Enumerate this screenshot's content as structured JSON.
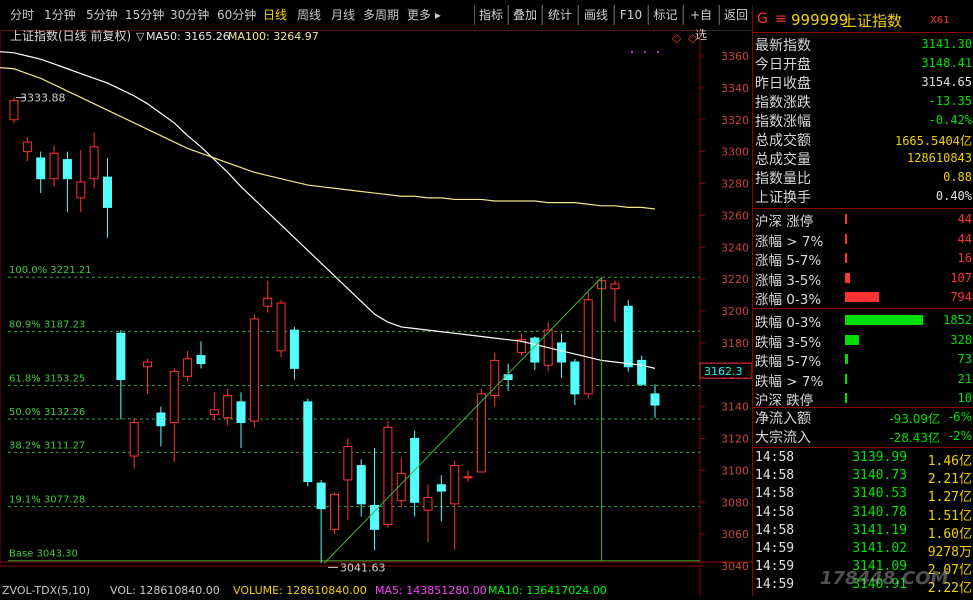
{
  "toolbar": {
    "periods": [
      "分时",
      "1分钟",
      "5分钟",
      "15分钟",
      "30分钟",
      "60分钟",
      "日线",
      "周线",
      "月线",
      "多周期",
      "更多 ▸"
    ],
    "active_period": "日线",
    "buttons": [
      "指标",
      "叠加",
      "统计",
      "画线",
      "F10",
      "标记",
      "+自选",
      "返回"
    ]
  },
  "chart": {
    "header_name": "上证指数(日线 前复权)",
    "header_marker": "▽",
    "ma50_label": "MA50: 3165.26",
    "ma100_label": "MA100: 3264.97",
    "high_label": "3333.88",
    "low_label": "3041.63",
    "current_price_tag": "3162.3",
    "fib_levels": [
      {
        "label": "100.0% 3221.21",
        "value": 3221.21
      },
      {
        "label": "80.9% 3187.23",
        "value": 3187.23
      },
      {
        "label": "61.8% 3153.25",
        "value": 3153.25
      },
      {
        "label": "50.0% 3132.26",
        "value": 3132.26
      },
      {
        "label": "38.2% 3111.27",
        "value": 3111.27
      },
      {
        "label": "19.1% 3077.28",
        "value": 3077.28
      },
      {
        "label": "Base 3043.30",
        "value": 3043.3
      }
    ],
    "y_axis_ticks": [
      3360,
      3340,
      3320,
      3300,
      3280,
      3260,
      3240,
      3220,
      3200,
      3180,
      3160,
      3140,
      3120,
      3100,
      3080,
      3060,
      3040
    ],
    "volume_header": {
      "name": "ZVOL-TDX(5,10)",
      "vol": "VOL: 128610840.00",
      "volume": "VOLUME: 128610840.00",
      "ma5": "MA5: 143851280.00",
      "ma10": "MA10: 136417024.00"
    },
    "colors": {
      "up": "#ff3232",
      "down": "#54ffff",
      "ma50": "#ffffff",
      "ma100": "#f0e68c",
      "fib": "#3c9a3c",
      "trend": "#3cb83c"
    }
  },
  "chart_data": {
    "type": "candlestick",
    "title": "上证指数(日线 前复权)",
    "ylim": [
      3035,
      3368
    ],
    "candles": [
      {
        "o": 3320,
        "c": 3332,
        "h": 3334,
        "l": 3318
      },
      {
        "o": 3300,
        "c": 3306,
        "h": 3309,
        "l": 3294
      },
      {
        "o": 3296,
        "c": 3283,
        "h": 3300,
        "l": 3274
      },
      {
        "o": 3283,
        "c": 3299,
        "h": 3304,
        "l": 3278
      },
      {
        "o": 3295,
        "c": 3283,
        "h": 3300,
        "l": 3262
      },
      {
        "o": 3271,
        "c": 3281,
        "h": 3301,
        "l": 3262
      },
      {
        "o": 3283,
        "c": 3303,
        "h": 3312,
        "l": 3277
      },
      {
        "o": 3284,
        "c": 3265,
        "h": 3296,
        "l": 3246
      },
      {
        "o": 3186,
        "c": 3157,
        "h": 3188,
        "l": 3132
      },
      {
        "o": 3109,
        "c": 3130,
        "h": 3133,
        "l": 3101
      },
      {
        "o": 3165,
        "c": 3168,
        "h": 3170,
        "l": 3148
      },
      {
        "o": 3136,
        "c": 3128,
        "h": 3140,
        "l": 3115
      },
      {
        "o": 3130,
        "c": 3162,
        "h": 3164,
        "l": 3105
      },
      {
        "o": 3159,
        "c": 3170,
        "h": 3175,
        "l": 3156
      },
      {
        "o": 3172,
        "c": 3167,
        "h": 3181,
        "l": 3164
      },
      {
        "o": 3135,
        "c": 3138,
        "h": 3149,
        "l": 3131
      },
      {
        "o": 3133,
        "c": 3147,
        "h": 3151,
        "l": 3128
      },
      {
        "o": 3143,
        "c": 3130,
        "h": 3149,
        "l": 3114
      },
      {
        "o": 3131,
        "c": 3195,
        "h": 3198,
        "l": 3127
      },
      {
        "o": 3203,
        "c": 3208,
        "h": 3219,
        "l": 3199
      },
      {
        "o": 3175,
        "c": 3205,
        "h": 3207,
        "l": 3171
      },
      {
        "o": 3188,
        "c": 3164,
        "h": 3190,
        "l": 3157
      },
      {
        "o": 3143,
        "c": 3093,
        "h": 3145,
        "l": 3090
      },
      {
        "o": 3092,
        "c": 3076,
        "h": 3094,
        "l": 3042
      },
      {
        "o": 3063,
        "c": 3085,
        "h": 3086,
        "l": 3060
      },
      {
        "o": 3094,
        "c": 3115,
        "h": 3120,
        "l": 3069
      },
      {
        "o": 3103,
        "c": 3079,
        "h": 3107,
        "l": 3071
      },
      {
        "o": 3078,
        "c": 3063,
        "h": 3114,
        "l": 3050
      },
      {
        "o": 3066,
        "c": 3127,
        "h": 3131,
        "l": 3064
      },
      {
        "o": 3081,
        "c": 3098,
        "h": 3108,
        "l": 3077
      },
      {
        "o": 3120,
        "c": 3080,
        "h": 3125,
        "l": 3071
      },
      {
        "o": 3075,
        "c": 3083,
        "h": 3091,
        "l": 3055
      },
      {
        "o": 3091,
        "c": 3087,
        "h": 3097,
        "l": 3068
      },
      {
        "o": 3079,
        "c": 3103,
        "h": 3106,
        "l": 3050
      },
      {
        "o": 3096,
        "c": 3096,
        "h": 3100,
        "l": 3093
      },
      {
        "o": 3099,
        "c": 3148,
        "h": 3151,
        "l": 3099
      },
      {
        "o": 3147,
        "c": 3169,
        "h": 3174,
        "l": 3140
      },
      {
        "o": 3160,
        "c": 3157,
        "h": 3167,
        "l": 3150
      },
      {
        "o": 3174,
        "c": 3182,
        "h": 3186,
        "l": 3172
      },
      {
        "o": 3183,
        "c": 3168,
        "h": 3184,
        "l": 3163
      },
      {
        "o": 3166,
        "c": 3188,
        "h": 3193,
        "l": 3162
      },
      {
        "o": 3180,
        "c": 3168,
        "h": 3186,
        "l": 3158
      },
      {
        "o": 3168,
        "c": 3148,
        "h": 3170,
        "l": 3141
      },
      {
        "o": 3148,
        "c": 3207,
        "h": 3212,
        "l": 3145
      },
      {
        "o": 3214,
        "c": 3219,
        "h": 3221,
        "l": 3201
      },
      {
        "o": 3214,
        "c": 3217,
        "h": 3219,
        "l": 3193
      },
      {
        "o": 3203,
        "c": 3165,
        "h": 3207,
        "l": 3162
      },
      {
        "o": 3169,
        "c": 3154,
        "h": 3172,
        "l": 3153
      },
      {
        "o": 3148,
        "c": 3141,
        "h": 3154,
        "l": 3133
      }
    ],
    "ma50": [
      3362,
      3360,
      3358,
      3355,
      3352,
      3349,
      3346,
      3343,
      3339,
      3335,
      3330,
      3324,
      3318,
      3310,
      3303,
      3295,
      3287,
      3278,
      3270,
      3262,
      3254,
      3246,
      3238,
      3230,
      3222,
      3214,
      3206,
      3198,
      3193,
      3190,
      3189,
      3188,
      3187,
      3186,
      3185,
      3184,
      3183,
      3182,
      3181,
      3179,
      3177,
      3175,
      3173,
      3171,
      3169,
      3168,
      3167,
      3166,
      3164
    ],
    "ma100": [
      3352,
      3349,
      3346,
      3342,
      3338,
      3334,
      3330,
      3326,
      3322,
      3318,
      3314,
      3310,
      3306,
      3302,
      3299,
      3296,
      3293,
      3290,
      3287,
      3285,
      3283,
      3281,
      3279,
      3278,
      3277,
      3276,
      3275,
      3274,
      3273,
      3272,
      3272,
      3271,
      3271,
      3270,
      3270,
      3270,
      3269,
      3269,
      3269,
      3269,
      3268,
      3268,
      3268,
      3267,
      3266,
      3266,
      3265,
      3265,
      3264
    ]
  },
  "panel": {
    "header": {
      "flag": "G",
      "menu": "≡",
      "code": "999999",
      "name": "上证指数",
      "tag": "X61"
    },
    "stats": [
      {
        "label": "最新指数",
        "value": "3141.30",
        "color": "#00e000"
      },
      {
        "label": "今日开盘",
        "value": "3148.41",
        "color": "#00e000"
      },
      {
        "label": "昨日收盘",
        "value": "3154.65",
        "color": "#e0e0e0"
      },
      {
        "label": "指数涨跌",
        "value": "-13.35",
        "color": "#00e000"
      },
      {
        "label": "指数涨幅",
        "value": "-0.42%",
        "color": "#00e000"
      },
      {
        "label": "总成交额",
        "value": "1665.5404亿",
        "color": "#f0d000"
      },
      {
        "label": "总成交量",
        "value": "128610843",
        "color": "#f0d000"
      },
      {
        "label": "指数量比",
        "value": "0.88",
        "color": "#f0d000"
      },
      {
        "label": "上证换手",
        "value": "0.40%",
        "color": "#e0e0e0"
      }
    ],
    "breadth": [
      {
        "label": "沪深 涨停",
        "value": "44",
        "color": "#ff3232",
        "bar": 0.005
      },
      {
        "label": "涨幅 > 7%",
        "value": "44",
        "color": "#ff3232",
        "bar": 0.005
      },
      {
        "label": "涨幅 5-7%",
        "value": "16",
        "color": "#ff3232",
        "bar": 0.005
      },
      {
        "label": "涨幅 3-5%",
        "value": "107",
        "color": "#ff3232",
        "bar": 0.07
      },
      {
        "label": "涨幅 0-3%",
        "value": "794",
        "color": "#ff3232",
        "bar": 0.43
      },
      {
        "label": "跌幅 0-3%",
        "value": "1852",
        "color": "#00e000",
        "bar": 1.0
      },
      {
        "label": "跌幅 3-5%",
        "value": "328",
        "color": "#00e000",
        "bar": 0.18
      },
      {
        "label": "跌幅 5-7%",
        "value": "73",
        "color": "#00e000",
        "bar": 0.04
      },
      {
        "label": "跌幅 > 7%",
        "value": "21",
        "color": "#00e000",
        "bar": 0.01
      },
      {
        "label": "沪深 跌停",
        "value": "10",
        "color": "#00e000",
        "bar": 0.005
      }
    ],
    "flows": [
      {
        "label": "净流入额",
        "value": "-93.09亿",
        "pct": "-6%"
      },
      {
        "label": "大宗流入",
        "value": "-28.43亿",
        "pct": "-2%"
      }
    ],
    "ticks": [
      {
        "time": "14:58",
        "price": "3139.99",
        "vol": "1.46亿"
      },
      {
        "time": "14:58",
        "price": "3140.73",
        "vol": "2.21亿"
      },
      {
        "time": "14:58",
        "price": "3140.53",
        "vol": "1.27亿"
      },
      {
        "time": "14:58",
        "price": "3140.78",
        "vol": "1.51亿"
      },
      {
        "time": "14:58",
        "price": "3141.19",
        "vol": "1.60亿"
      },
      {
        "time": "14:59",
        "price": "3141.02",
        "vol": "9278万"
      },
      {
        "time": "14:59",
        "price": "3141.09",
        "vol": "2.07亿"
      },
      {
        "time": "14:59",
        "price": "3140.91",
        "vol": "2.22亿"
      }
    ]
  },
  "watermark": "178448.COM"
}
